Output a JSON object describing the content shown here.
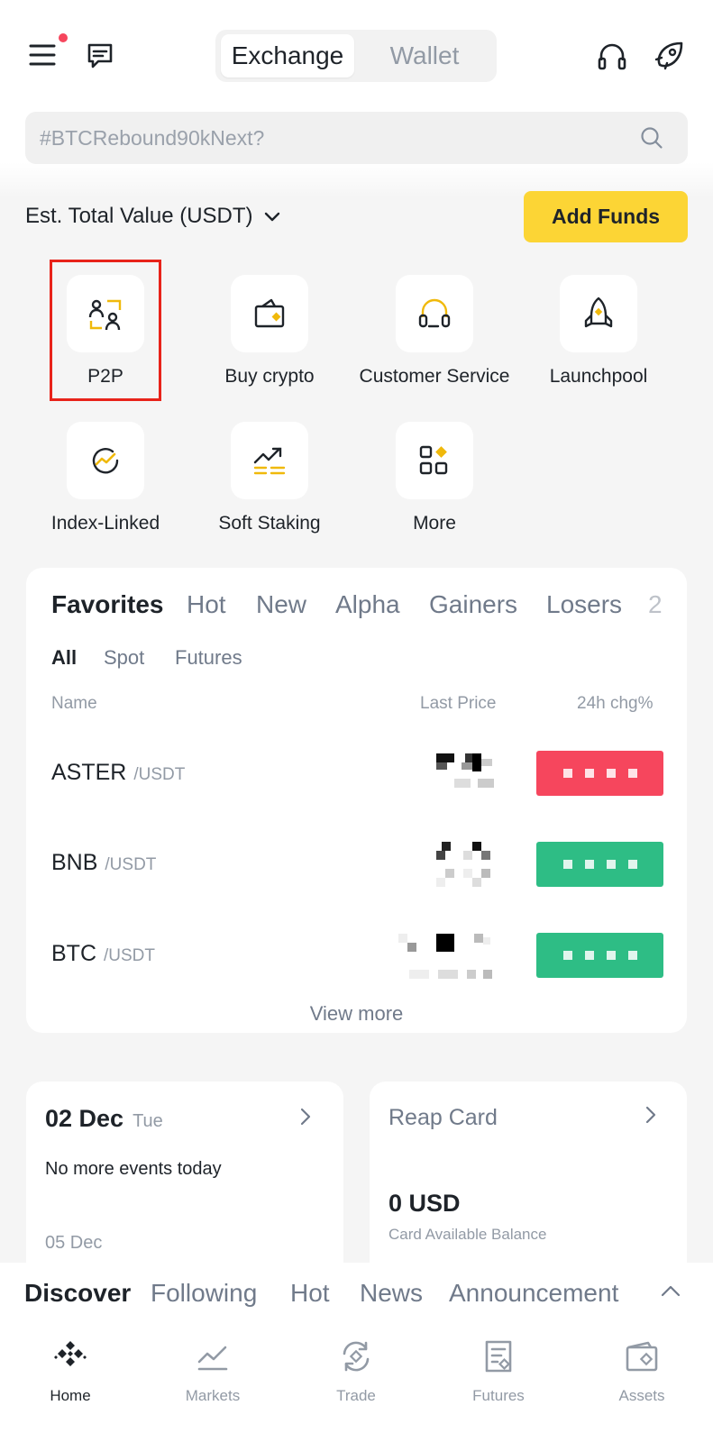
{
  "header": {
    "menu_icon": "hamburger-menu-icon",
    "messages_icon": "chat-message-icon",
    "tabs": [
      {
        "label": "Exchange",
        "active": true
      },
      {
        "label": "Wallet",
        "active": false
      }
    ],
    "support_icon": "headset-icon",
    "profile_icon": "rocket-avatar-icon",
    "notification_color": "#f6465d"
  },
  "search": {
    "placeholder": "#BTCRebound90kNext?",
    "icon": "search-icon"
  },
  "balance": {
    "label": "Est. Total Value (USDT)",
    "add_funds_label": "Add Funds",
    "accent_color": "#fcd535"
  },
  "shortcuts": [
    {
      "label": "P2P",
      "icon": "p2p-icon"
    },
    {
      "label": "Buy crypto",
      "icon": "buy-crypto-icon"
    },
    {
      "label": "Customer Service",
      "icon": "customer-service-icon"
    },
    {
      "label": "Launchpool",
      "icon": "launchpool-icon"
    },
    {
      "label": "Index-Linked",
      "icon": "index-linked-icon"
    },
    {
      "label": "Soft Staking",
      "icon": "soft-staking-icon"
    },
    {
      "label": "More",
      "icon": "more-icon"
    }
  ],
  "market": {
    "tabs": [
      "Favorites",
      "Hot",
      "New",
      "Alpha",
      "Gainers",
      "Losers",
      "2"
    ],
    "active_tab": "Favorites",
    "subtabs": [
      "All",
      "Spot",
      "Futures"
    ],
    "active_subtab": "All",
    "columns": {
      "name": "Name",
      "last_price": "Last Price",
      "change": "24h chg%"
    },
    "rows": [
      {
        "symbol": "ASTER",
        "quote": "/USDT",
        "trend": "down"
      },
      {
        "symbol": "BNB",
        "quote": "/USDT",
        "trend": "up"
      },
      {
        "symbol": "BTC",
        "quote": "/USDT",
        "trend": "up"
      }
    ],
    "view_more": "View more",
    "up_color": "#2ebd85",
    "down_color": "#f6465d"
  },
  "events": {
    "date": "02 Dec",
    "weekday": "Tue",
    "message": "No more events today",
    "next_date": "05 Dec"
  },
  "reap_card": {
    "title": "Reap Card",
    "amount": "0 USD",
    "caption": "Card Available Balance"
  },
  "feed_tabs": [
    "Discover",
    "Following",
    "Hot",
    "News",
    "Announcement"
  ],
  "feed_active": "Discover",
  "bottom_nav": [
    {
      "label": "Home",
      "icon": "home-icon",
      "active": true
    },
    {
      "label": "Markets",
      "icon": "markets-icon",
      "active": false
    },
    {
      "label": "Trade",
      "icon": "trade-icon",
      "active": false
    },
    {
      "label": "Futures",
      "icon": "futures-icon",
      "active": false
    },
    {
      "label": "Assets",
      "icon": "assets-icon",
      "active": false
    }
  ]
}
